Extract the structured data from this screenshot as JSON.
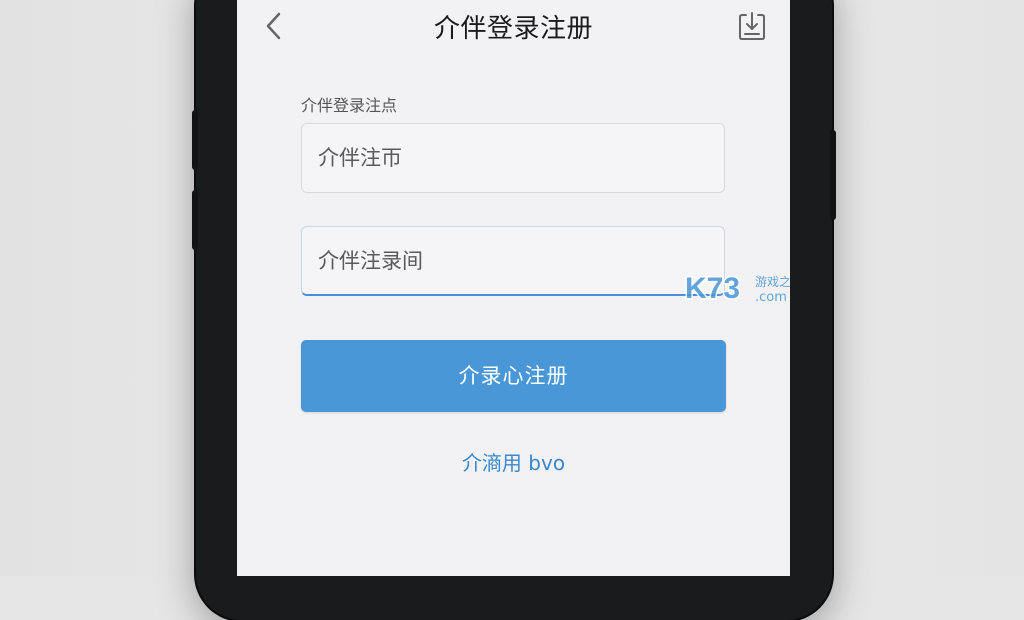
{
  "header": {
    "title": "介伴登录注册",
    "back_icon": "chevron-left-icon",
    "download_icon": "download-tray-icon"
  },
  "form": {
    "label": "介伴登录注点",
    "field1_placeholder": "介伴注帀",
    "field2_placeholder": "介伴注录间",
    "submit_label": "介录心注册",
    "link_label": "介滳用 bvo"
  },
  "watermark": {
    "brand": "K73",
    "tagline": "游戏之家",
    "domain": ".com"
  },
  "colors": {
    "accent": "#4a97d7",
    "link": "#3a87cf",
    "screen_bg": "#f2f2f4",
    "phone_body": "#1a1b1c"
  }
}
